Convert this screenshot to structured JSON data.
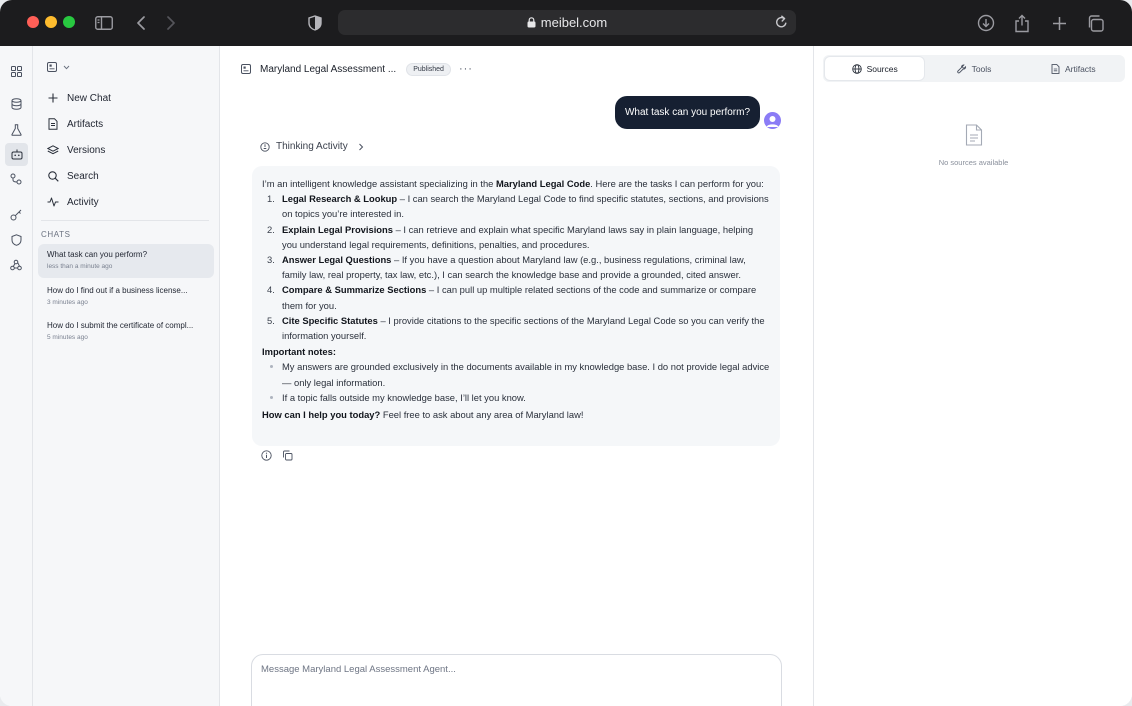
{
  "browser": {
    "url": "meibel.com"
  },
  "sidebar": {
    "nav": [
      {
        "label": "New Chat",
        "icon": "plus-icon"
      },
      {
        "label": "Artifacts",
        "icon": "document-icon"
      },
      {
        "label": "Versions",
        "icon": "layers-icon"
      },
      {
        "label": "Search",
        "icon": "search-icon"
      },
      {
        "label": "Activity",
        "icon": "activity-icon"
      }
    ],
    "chats_label": "CHATS",
    "chats": [
      {
        "title": "What task can you perform?",
        "time": "less than a minute ago"
      },
      {
        "title": "How do I find out if a business license...",
        "time": "3 minutes ago"
      },
      {
        "title": "How do I submit the certificate of compl...",
        "time": "5 minutes ago"
      }
    ]
  },
  "header": {
    "title": "Maryland Legal Assessment ...",
    "badge": "Published",
    "more": "···"
  },
  "conversation": {
    "user_message": "What task can you perform?",
    "thinking_label": "Thinking Activity",
    "intro_pre": "I’m an intelligent knowledge assistant specializing in the ",
    "intro_bold": "Maryland Legal Code",
    "intro_post": ". Here are the tasks I can perform for you:",
    "tasks": [
      {
        "num": "1.",
        "title": "Legal Research & Lookup",
        "text": " – I can search the Maryland Legal Code to find specific statutes, sections, and provisions on topics you’re interested in."
      },
      {
        "num": "2.",
        "title": "Explain Legal Provisions",
        "text": " – I can retrieve and explain what specific Maryland laws say in plain language, helping you understand legal requirements, definitions, penalties, and procedures."
      },
      {
        "num": "3.",
        "title": "Answer Legal Questions",
        "text": " – If you have a question about Maryland law (e.g., business regulations, criminal law, family law, real property, tax law, etc.), I can search the knowledge base and provide a grounded, cited answer."
      },
      {
        "num": "4.",
        "title": "Compare & Summarize Sections",
        "text": " – I can pull up multiple related sections of the code and summarize or compare them for you."
      },
      {
        "num": "5.",
        "title": "Cite Specific Statutes",
        "text": " – I provide citations to the specific sections of the Maryland Legal Code so you can verify the information yourself."
      }
    ],
    "notes_heading": "Important notes:",
    "notes": [
      "My answers are grounded exclusively in the documents available in my knowledge base. I do not provide legal advice — only legal information.",
      "If a topic falls outside my knowledge base, I’ll let you know."
    ],
    "closing_bold": "How can I help you today?",
    "closing_text": " Feel free to ask about any area of Maryland law!"
  },
  "composer": {
    "placeholder": "Message Maryland Legal Assessment Agent..."
  },
  "right_panel": {
    "tabs": [
      {
        "label": "Sources",
        "icon": "globe-icon",
        "active": true
      },
      {
        "label": "Tools",
        "icon": "wrench-icon",
        "active": false
      },
      {
        "label": "Artifacts",
        "icon": "document-icon",
        "active": false
      }
    ],
    "empty_text": "No sources available"
  },
  "colors": {
    "user_bubble": "#162032",
    "avatar": "#8b7cf6",
    "titlebar": "#1c1c1e"
  }
}
